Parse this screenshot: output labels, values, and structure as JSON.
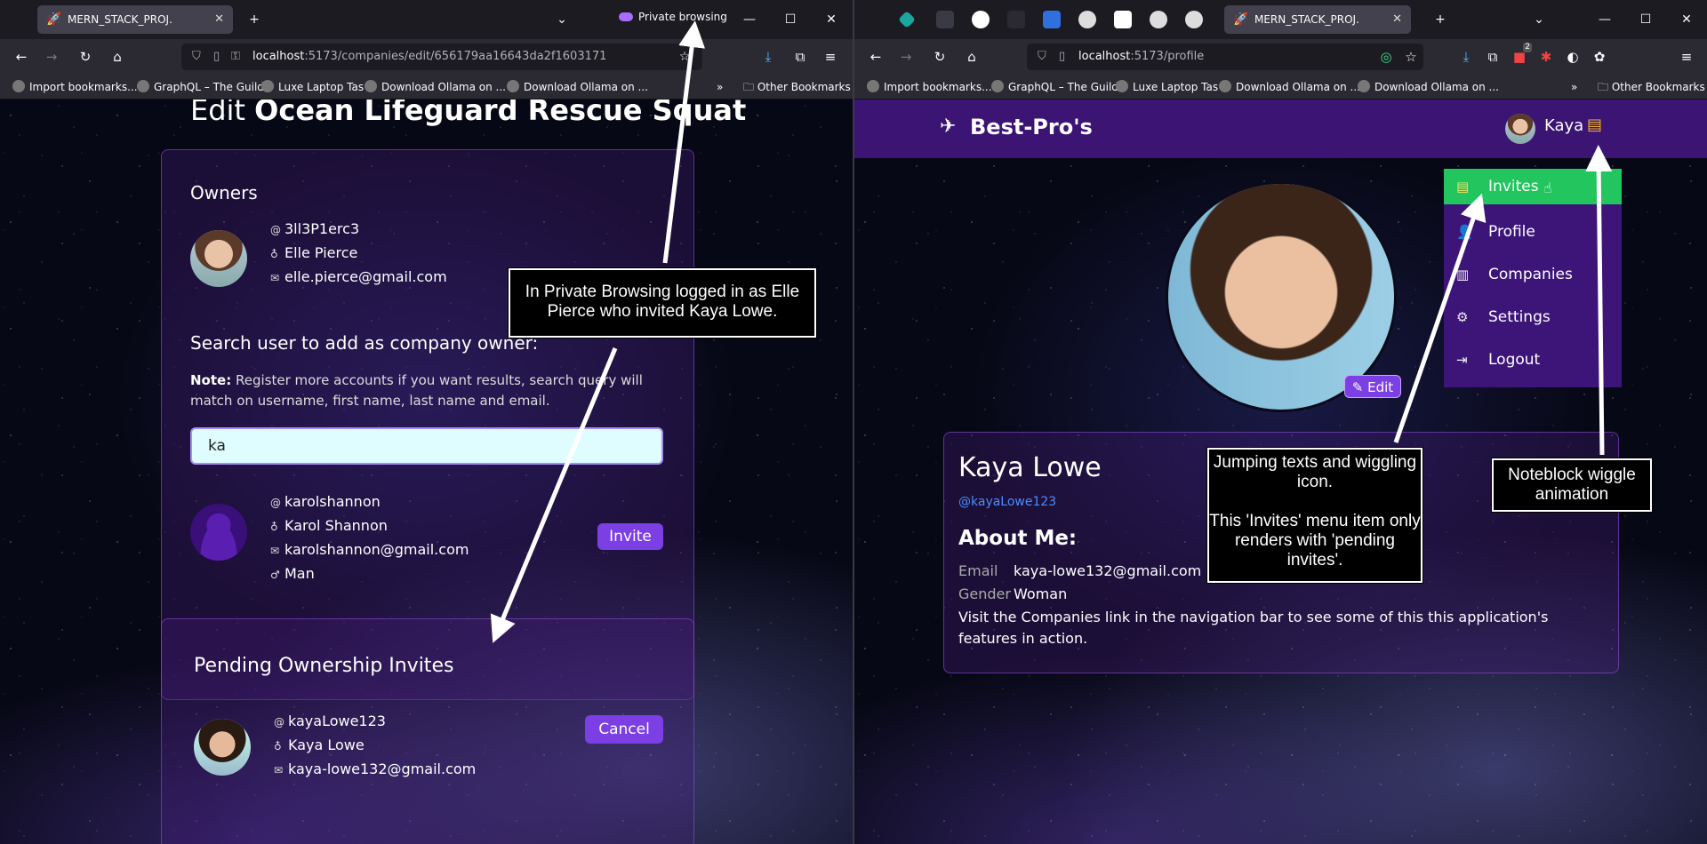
{
  "left": {
    "tab": {
      "title": "MERN_STACK_PROJ.",
      "private_label": "Private browsing"
    },
    "url": {
      "host": "localhost",
      "path": ":5173/companies/edit/656179aa16643da2f1603171"
    },
    "bookmarks": [
      "Import bookmarks...",
      "GraphQL – The Guild",
      "Luxe Laptop Tas",
      "Download Ollama on ...",
      "Download Ollama on ..."
    ],
    "other_bookmarks": "Other Bookmarks",
    "heading_prefix": "Edit",
    "heading_name": "Ocean Lifeguard Rescue Squat",
    "owners": {
      "title": "Owners",
      "username": "3ll3P1erc3",
      "name": "Elle Pierce",
      "email": "elle.pierce@gmail.com"
    },
    "search": {
      "title": "Search user to add as company owner:",
      "note_label": "Note:",
      "note_text": "Register more accounts if you want results, search query will match on username, first name, last name and email.",
      "query": "ka"
    },
    "result": {
      "username": "karolshannon",
      "name": "Karol Shannon",
      "email": "karolshannon@gmail.com",
      "gender": "Man",
      "invite_label": "Invite"
    },
    "pending": {
      "title": "Pending Ownership Invites",
      "username": "kayaLowe123",
      "name": "Kaya Lowe",
      "email": "kaya-lowe132@gmail.com",
      "cancel_label": "Cancel"
    },
    "callout": "In Private Browsing logged in as Elle Pierce who invited Kaya Lowe."
  },
  "right": {
    "tab": {
      "title": "MERN_STACK_PROJ."
    },
    "url": {
      "host": "localhost",
      "path": ":5173/profile"
    },
    "bookmarks": [
      "Import bookmarks...",
      "GraphQL – The Guild",
      "Luxe Laptop Tas",
      "Download Ollama on ...",
      "Download Ollama on ..."
    ],
    "other_bookmarks": "Other Bookmarks",
    "brand": "Best-Pro's",
    "nav_user": "Kaya",
    "menu": [
      "Invites",
      "Profile",
      "Companies",
      "Settings",
      "Logout"
    ],
    "edit_label": "Edit",
    "profile": {
      "name": "Kaya Lowe",
      "handle": "@kayaLowe123",
      "about_title": "About Me:",
      "email_label": "Email",
      "email": "kaya-lowe132@gmail.com",
      "gender_label": "Gender",
      "gender": "Woman",
      "blurb": "Visit the Companies link in the navigation bar to see some of this this application's features in action."
    },
    "callout_invites": "Jumping texts and wiggling icon.\n\nThis 'Invites' menu item only renders with 'pending invites'.",
    "callout_noteblock": "Noteblock wiggle animation",
    "ext_badge": "2"
  },
  "colors": {
    "accent": "#7b3fe4",
    "invites_green": "#22c55e",
    "nav_purple": "#3b1474"
  }
}
